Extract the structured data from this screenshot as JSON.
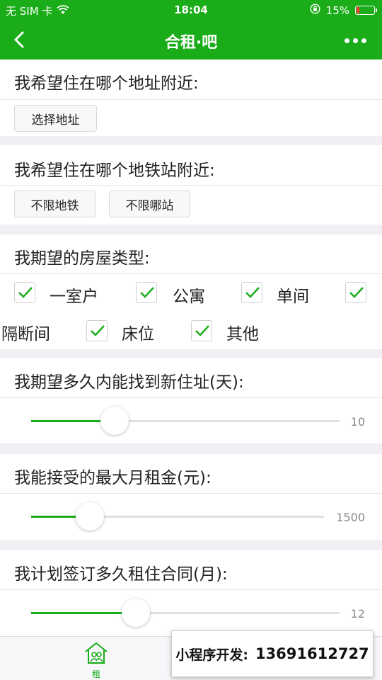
{
  "status_bar": {
    "carrier": "无 SIM 卡",
    "time": "18:04",
    "battery_percent": "15%",
    "battery_level": 0.15
  },
  "nav": {
    "title": "合租·吧"
  },
  "address": {
    "question": "我希望住在哪个地址附近:",
    "select_button": "选择地址"
  },
  "subway": {
    "question": "我希望住在哪个地铁站附近:",
    "line_button": "不限地铁",
    "station_button": "不限哪站"
  },
  "house_type": {
    "question": "我期望的房屋类型:",
    "options": [
      {
        "label": "一室户",
        "checked": true
      },
      {
        "label": "公寓",
        "checked": true
      },
      {
        "label": "单间",
        "checked": true
      },
      {
        "label": "隔断间",
        "checked": true
      },
      {
        "label": "床位",
        "checked": true
      },
      {
        "label": "其他",
        "checked": true
      }
    ]
  },
  "days": {
    "question": "我期望多久内能找到新住址(天):",
    "value": "10",
    "fraction": 0.27
  },
  "rent": {
    "question": "我能接受的最大月租金(元):",
    "value": "1500",
    "fraction": 0.2
  },
  "contract": {
    "question": "我计划签订多久租住合同(月):",
    "value": "12",
    "fraction": 0.34
  },
  "tabbar": {
    "home_label": "租"
  },
  "ad": {
    "label": "小程序开发:",
    "phone": "13691612727"
  },
  "colors": {
    "accent": "#1aad19",
    "background": "#efeff4",
    "battery_low": "#ff3b30"
  }
}
